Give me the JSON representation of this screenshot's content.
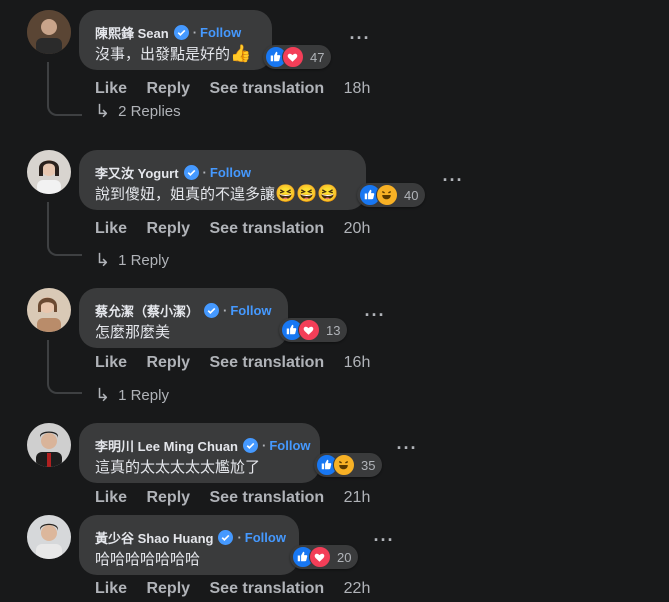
{
  "follow_label": "Follow",
  "actions": {
    "like": "Like",
    "reply": "Reply",
    "see_translation": "See translation"
  },
  "colors": {
    "background": "#18191a",
    "bubble": "#3a3b3c",
    "follow": "#4599ff",
    "like": "#1877f2",
    "love": "#f33e58",
    "haha": "#f7b125"
  },
  "comments": [
    {
      "name": "陳熙鋒 Sean",
      "text": "沒事，出發點是好的",
      "emoji": "👍",
      "reaction_types": [
        "like-icon",
        "love-icon"
      ],
      "reaction_count": "47",
      "time": "18h",
      "replies": "2 Replies"
    },
    {
      "name": "李又汝 Yogurt",
      "text": "說到傻妞，姐真的不遑多讓",
      "emoji": "😆😆😆",
      "reaction_types": [
        "like-icon",
        "haha-icon"
      ],
      "reaction_count": "40",
      "time": "20h",
      "replies": "1 Reply"
    },
    {
      "name": "蔡允潔（蔡小潔）",
      "text": "怎麼那麼美",
      "emoji": "",
      "reaction_types": [
        "like-icon",
        "love-icon"
      ],
      "reaction_count": "13",
      "time": "16h",
      "replies": "1 Reply"
    },
    {
      "name": "李明川 Lee Ming Chuan",
      "text": "這真的太太太太太尷尬了",
      "emoji": "",
      "reaction_types": [
        "like-icon",
        "haha-icon"
      ],
      "reaction_count": "35",
      "time": "21h",
      "replies": ""
    },
    {
      "name": "黃少谷 Shao Huang",
      "text": "哈哈哈哈哈哈哈",
      "emoji": "",
      "reaction_types": [
        "like-icon",
        "love-icon"
      ],
      "reaction_count": "20",
      "time": "22h",
      "replies": ""
    }
  ]
}
